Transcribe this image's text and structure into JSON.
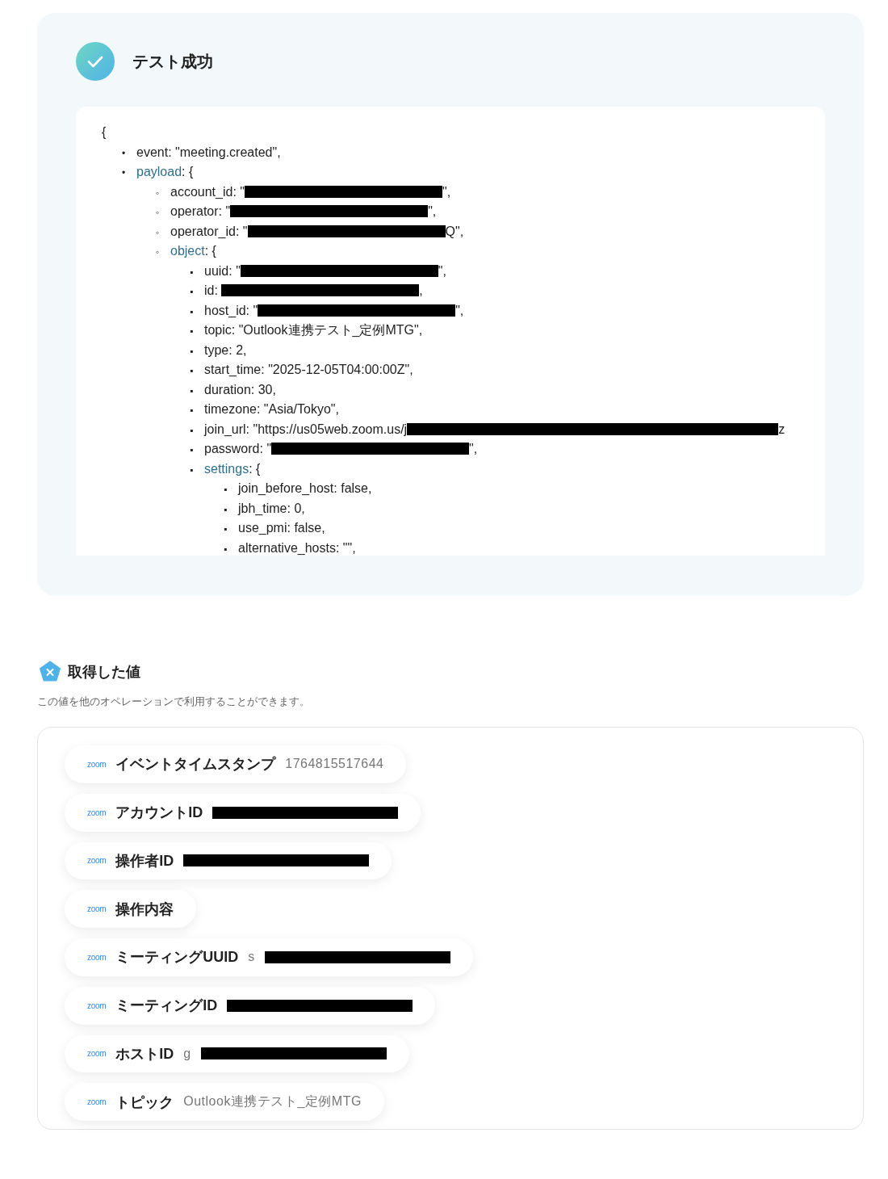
{
  "result": {
    "title": "テスト成功",
    "open_brace": "{",
    "lines": [
      {
        "marker": "•",
        "key": "event",
        "before": ": \"meeting.created\","
      },
      {
        "marker": "•",
        "key": "payload",
        "before": ": {",
        "expandable": true,
        "children": [
          {
            "marker": "◦",
            "key": "account_id",
            "before": ": \"",
            "redacted": true,
            "after": "\","
          },
          {
            "marker": "◦",
            "key": "operator",
            "before": ": \"",
            "redacted": true,
            "after": "\","
          },
          {
            "marker": "◦",
            "key": "operator_id",
            "before": ": \"",
            "redacted": true,
            "after": "Q\","
          },
          {
            "marker": "◦",
            "key": "object",
            "before": ": {",
            "expandable": true,
            "children": [
              {
                "marker": "▪",
                "key": "uuid",
                "before": ": \"",
                "redacted": true,
                "after": "\","
              },
              {
                "marker": "▪",
                "key": "id",
                "before": ": ",
                "redacted": true,
                "after": ","
              },
              {
                "marker": "▪",
                "key": "host_id",
                "before": ": \"",
                "redacted": true,
                "after": "\","
              },
              {
                "marker": "▪",
                "key": "topic",
                "before": ": \"Outlook連携テスト_定例MTG\","
              },
              {
                "marker": "▪",
                "key": "type",
                "before": ": 2,"
              },
              {
                "marker": "▪",
                "key": "start_time",
                "before": ": \"2025-12-05T04:00:00Z\","
              },
              {
                "marker": "▪",
                "key": "duration",
                "before": ": 30,"
              },
              {
                "marker": "▪",
                "key": "timezone",
                "before": ": \"Asia/Tokyo\","
              },
              {
                "marker": "▪",
                "key": "join_url",
                "before": ": \"https://us05web.zoom.us/j",
                "redacted": true,
                "after": "z"
              },
              {
                "marker": "▪",
                "key": "password",
                "before": ": \"",
                "redacted": true,
                "after": "\","
              },
              {
                "marker": "▪",
                "key": "settings",
                "before": ": {",
                "expandable": true,
                "children": [
                  {
                    "marker": "▪",
                    "key": "join_before_host",
                    "before": ": false,"
                  },
                  {
                    "marker": "▪",
                    "key": "jbh_time",
                    "before": ": 0,"
                  },
                  {
                    "marker": "▪",
                    "key": "use_pmi",
                    "before": ": false,"
                  },
                  {
                    "marker": "▪",
                    "key": "alternative_hosts",
                    "before": ": \"\","
                  }
                ]
              }
            ]
          }
        ]
      }
    ]
  },
  "values": {
    "title": "取得した値",
    "description": "この値を他のオペレーションで利用することができます。",
    "items": [
      {
        "source": "zoom",
        "label": "イベントタイムスタンプ",
        "value": "1764815517644"
      },
      {
        "source": "zoom",
        "label": "アカウントID",
        "redacted": true
      },
      {
        "source": "zoom",
        "label": "操作者ID",
        "redacted": true
      },
      {
        "source": "zoom",
        "label": "操作内容"
      },
      {
        "source": "zoom",
        "label": "ミーティングUUID",
        "value": "s",
        "redacted": true
      },
      {
        "source": "zoom",
        "label": "ミーティングID",
        "redacted": true
      },
      {
        "source": "zoom",
        "label": "ホストID",
        "value": "g",
        "redacted": true
      },
      {
        "source": "zoom",
        "label": "トピック",
        "value": "Outlook連携テスト_定例MTG"
      }
    ]
  }
}
